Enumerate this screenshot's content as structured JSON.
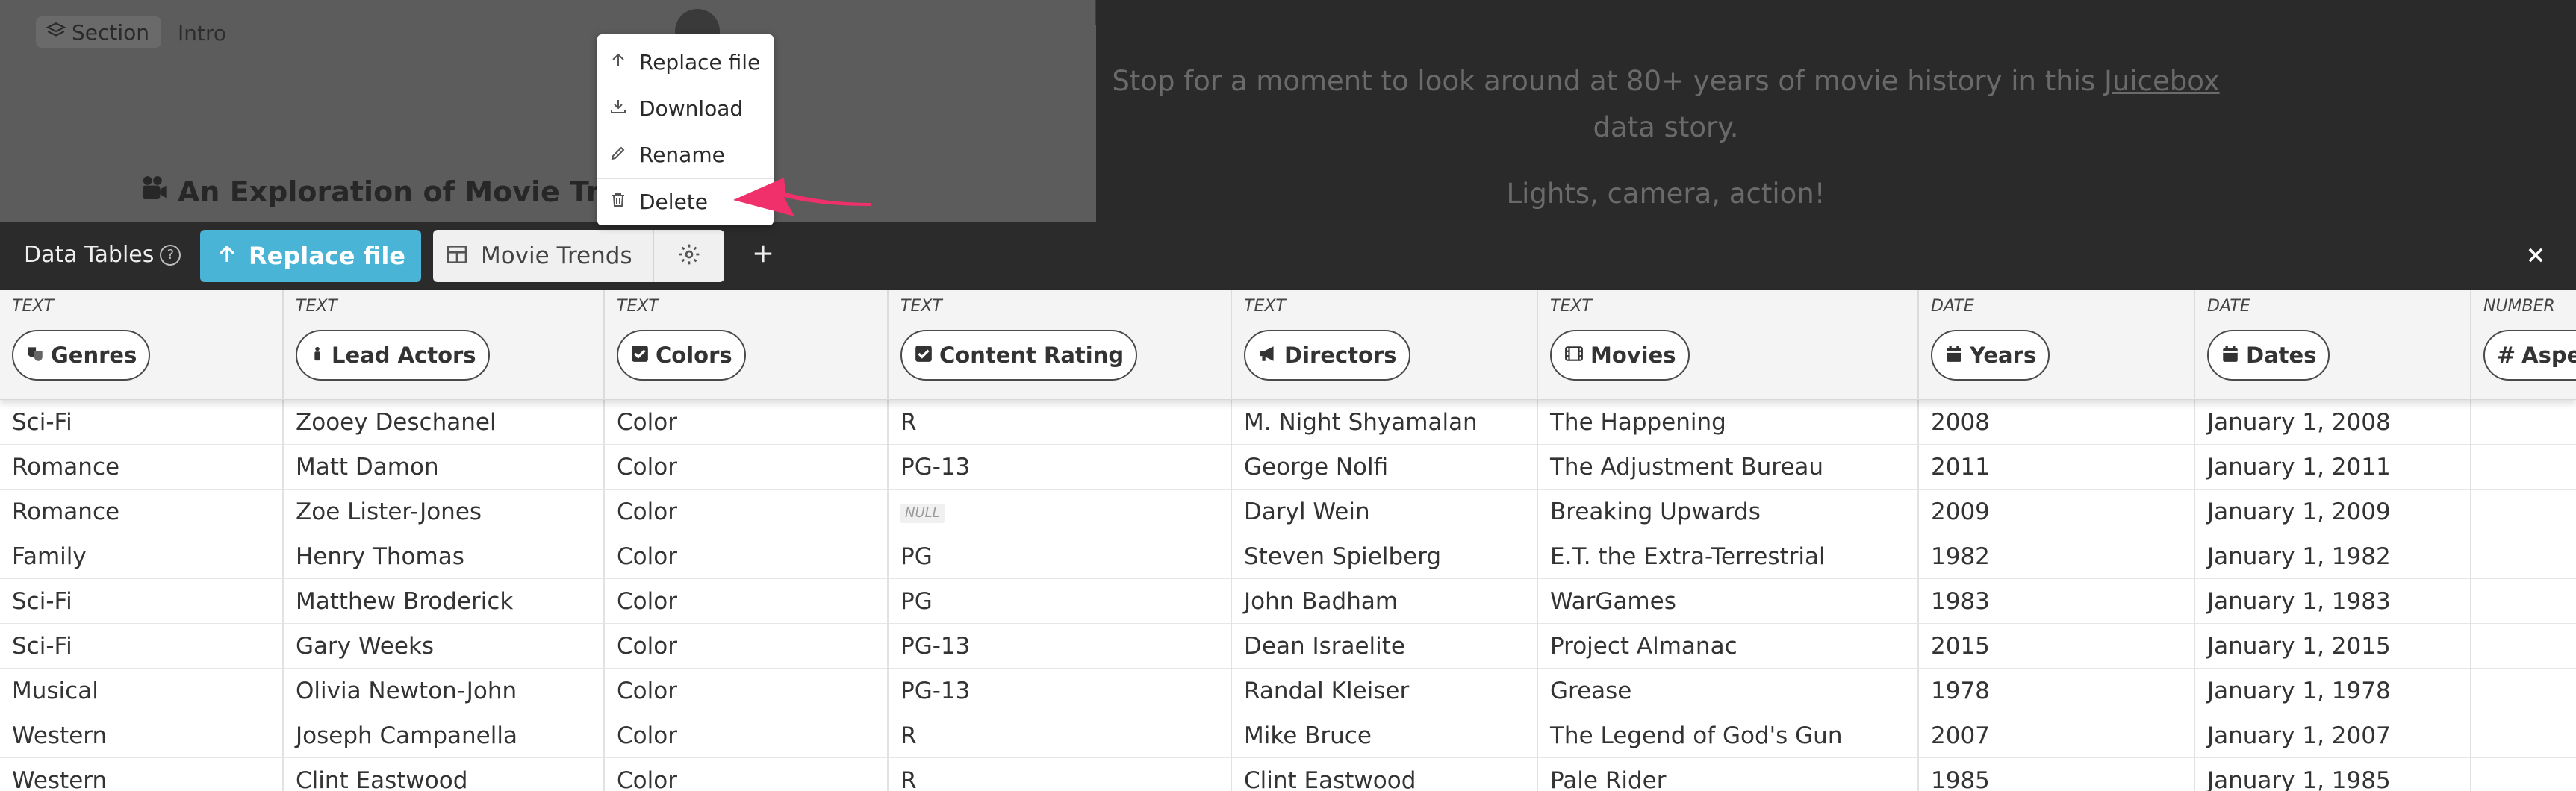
{
  "story": {
    "section_label": "Section",
    "intro_label": "Intro",
    "title": "An Exploration of Movie Trends",
    "body_prefix": "Stop for a moment to look around at 80+ years of movie history in this ",
    "body_link": "Juicebox",
    "body_suffix": " data story.",
    "action_text": "Lights, camera, action!"
  },
  "context_menu": {
    "items": [
      {
        "label": "Replace file",
        "icon": "arrow-up-icon"
      },
      {
        "label": "Download",
        "icon": "download-icon"
      },
      {
        "label": "Rename",
        "icon": "pencil-icon"
      },
      {
        "label": "Delete",
        "icon": "trash-icon"
      }
    ],
    "annotation_arrow_color": "#f0306a"
  },
  "toolbar": {
    "data_tables_label": "Data Tables",
    "replace_label": "Replace file",
    "replace_color": "#4ab4d6",
    "table_tab_label": "Movie Trends"
  },
  "columns": [
    {
      "type": "TEXT",
      "name": "Genres",
      "icon": "theater-masks-icon"
    },
    {
      "type": "TEXT",
      "name": "Lead Actors",
      "icon": "person-icon"
    },
    {
      "type": "TEXT",
      "name": "Colors",
      "icon": "checkbox-icon"
    },
    {
      "type": "TEXT",
      "name": "Content Rating",
      "icon": "checkbox-icon"
    },
    {
      "type": "TEXT",
      "name": "Directors",
      "icon": "megaphone-icon"
    },
    {
      "type": "TEXT",
      "name": "Movies",
      "icon": "film-icon"
    },
    {
      "type": "DATE",
      "name": "Years",
      "icon": "calendar-icon"
    },
    {
      "type": "DATE",
      "name": "Dates",
      "icon": "calendar-icon"
    },
    {
      "type": "NUMBER",
      "name": "Aspect",
      "icon": "hash-icon"
    }
  ],
  "null_label": "NULL",
  "rows": [
    [
      "Sci-Fi",
      "Zooey Deschanel",
      "Color",
      "R",
      "M. Night Shyamalan",
      "The Happening",
      "2008",
      "January 1, 2008"
    ],
    [
      "Romance",
      "Matt Damon",
      "Color",
      "PG-13",
      "George Nolfi",
      "The Adjustment Bureau",
      "2011",
      "January 1, 2011"
    ],
    [
      "Romance",
      "Zoe Lister-Jones",
      "Color",
      null,
      "Daryl Wein",
      "Breaking Upwards",
      "2009",
      "January 1, 2009"
    ],
    [
      "Family",
      "Henry Thomas",
      "Color",
      "PG",
      "Steven Spielberg",
      "E.T. the Extra-Terrestrial",
      "1982",
      "January 1, 1982"
    ],
    [
      "Sci-Fi",
      "Matthew Broderick",
      "Color",
      "PG",
      "John Badham",
      "WarGames",
      "1983",
      "January 1, 1983"
    ],
    [
      "Sci-Fi",
      "Gary Weeks",
      "Color",
      "PG-13",
      "Dean Israelite",
      "Project Almanac",
      "2015",
      "January 1, 2015"
    ],
    [
      "Musical",
      "Olivia Newton-John",
      "Color",
      "PG-13",
      "Randal Kleiser",
      "Grease",
      "1978",
      "January 1, 1978"
    ],
    [
      "Western",
      "Joseph Campanella",
      "Color",
      "R",
      "Mike Bruce",
      "The Legend of God's Gun",
      "2007",
      "January 1, 2007"
    ],
    [
      "Western",
      "Clint Eastwood",
      "Color",
      "R",
      "Clint Eastwood",
      "Pale Rider",
      "1985",
      "January 1, 1985"
    ]
  ]
}
